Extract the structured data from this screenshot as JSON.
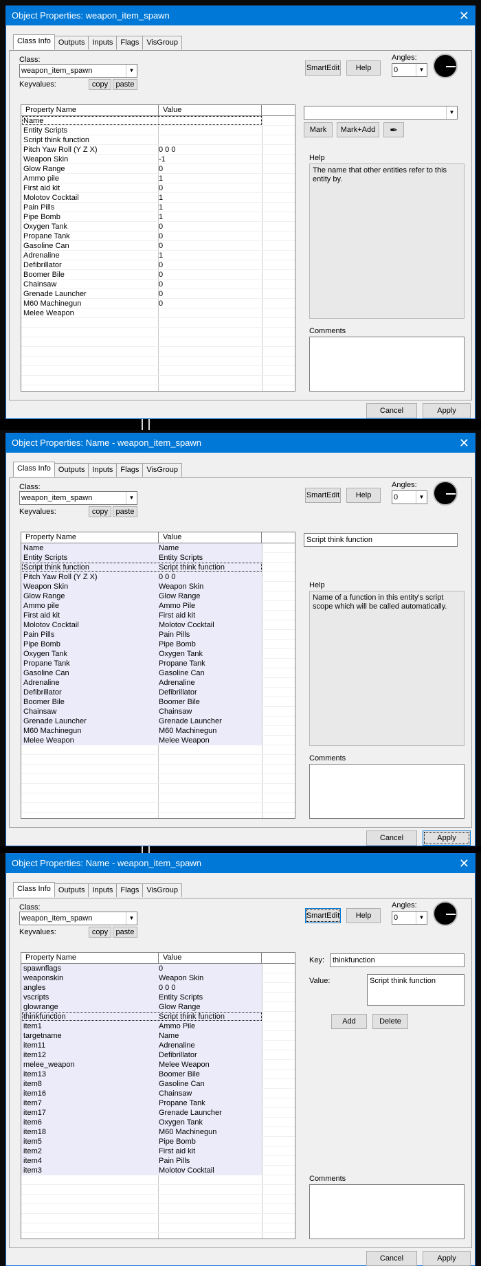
{
  "windows": [
    {
      "title": "Object Properties: weapon_item_spawn",
      "tabs": [
        "Class Info",
        "Outputs",
        "Inputs",
        "Flags",
        "VisGroup"
      ],
      "class_label": "Class:",
      "class_value": "weapon_item_spawn",
      "keyvalues_label": "Keyvalues:",
      "copy_label": "copy",
      "paste_label": "paste",
      "smartedit_label": "SmartEdit",
      "help_label": "Help",
      "angles_label": "Angles:",
      "angles_value": "0",
      "col_property": "Property Name",
      "col_value": "Value",
      "help_heading": "Help",
      "help_text": "The name that other entities refer to this entity by.",
      "comments_label": "Comments",
      "mark_label": "Mark",
      "markadd_label": "Mark+Add",
      "cancel_label": "Cancel",
      "apply_label": "Apply",
      "rows": [
        [
          "Name",
          ""
        ],
        [
          "Entity Scripts",
          ""
        ],
        [
          "Script think function",
          ""
        ],
        [
          "Pitch Yaw Roll (Y Z X)",
          "0 0 0"
        ],
        [
          "Weapon Skin",
          "-1"
        ],
        [
          "Glow Range",
          "0"
        ],
        [
          "Ammo pile",
          "1"
        ],
        [
          "First aid kit",
          "0"
        ],
        [
          "Molotov Cocktail",
          "1"
        ],
        [
          "Pain Pills",
          "1"
        ],
        [
          "Pipe Bomb",
          "1"
        ],
        [
          "Oxygen Tank",
          "0"
        ],
        [
          "Propane Tank",
          "0"
        ],
        [
          "Gasoline Can",
          "0"
        ],
        [
          "Adrenaline",
          "1"
        ],
        [
          "Defibrillator",
          "0"
        ],
        [
          "Boomer Bile",
          "0"
        ],
        [
          "Chainsaw",
          "0"
        ],
        [
          "Grenade Launcher",
          "0"
        ],
        [
          "M60 Machinegun",
          "0"
        ],
        [
          "Melee Weapon",
          ""
        ]
      ]
    },
    {
      "title": "Object Properties: Name - weapon_item_spawn",
      "tabs": [
        "Class Info",
        "Outputs",
        "Inputs",
        "Flags",
        "VisGroup"
      ],
      "class_label": "Class:",
      "class_value": "weapon_item_spawn",
      "keyvalues_label": "Keyvalues:",
      "copy_label": "copy",
      "paste_label": "paste",
      "smartedit_label": "SmartEdit",
      "help_label": "Help",
      "angles_label": "Angles:",
      "angles_value": "0",
      "col_property": "Property Name",
      "col_value": "Value",
      "field_value": "Script think function",
      "help_heading": "Help",
      "help_text": "Name of a function in this entity's script scope which will be called automatically.",
      "comments_label": "Comments",
      "cancel_label": "Cancel",
      "apply_label": "Apply",
      "rows": [
        [
          "Name",
          "Name"
        ],
        [
          "Entity Scripts",
          "Entity Scripts"
        ],
        [
          "Script think function",
          "Script think function"
        ],
        [
          "Pitch Yaw Roll (Y Z X)",
          "0 0 0"
        ],
        [
          "Weapon Skin",
          "Weapon Skin"
        ],
        [
          "Glow Range",
          "Glow Range"
        ],
        [
          "Ammo pile",
          "Ammo Pile"
        ],
        [
          "First aid kit",
          "First aid kit"
        ],
        [
          "Molotov Cocktail",
          "Molotov Cocktail"
        ],
        [
          "Pain Pills",
          "Pain Pills"
        ],
        [
          "Pipe Bomb",
          "Pipe Bomb"
        ],
        [
          "Oxygen Tank",
          "Oxygen Tank"
        ],
        [
          "Propane Tank",
          "Propane Tank"
        ],
        [
          "Gasoline Can",
          "Gasoline Can"
        ],
        [
          "Adrenaline",
          "Adrenaline"
        ],
        [
          "Defibrillator",
          "Defibrillator"
        ],
        [
          "Boomer Bile",
          "Boomer Bile"
        ],
        [
          "Chainsaw",
          "Chainsaw"
        ],
        [
          "Grenade Launcher",
          "Grenade Launcher"
        ],
        [
          "M60 Machinegun",
          "M60 Machinegun"
        ],
        [
          "Melee Weapon",
          "Melee Weapon"
        ]
      ]
    },
    {
      "title": "Object Properties: Name - weapon_item_spawn",
      "tabs": [
        "Class Info",
        "Outputs",
        "Inputs",
        "Flags",
        "VisGroup"
      ],
      "class_label": "Class:",
      "class_value": "weapon_item_spawn",
      "keyvalues_label": "Keyvalues:",
      "copy_label": "copy",
      "paste_label": "paste",
      "smartedit_label": "SmartEdit",
      "help_label": "Help",
      "angles_label": "Angles:",
      "angles_value": "0",
      "col_property": "Property Name",
      "col_value": "Value",
      "key_label": "Key:",
      "key_value": "thinkfunction",
      "value_label": "Value:",
      "value_value": "Script think function",
      "add_label": "Add",
      "delete_label": "Delete",
      "comments_label": "Comments",
      "cancel_label": "Cancel",
      "apply_label": "Apply",
      "rows": [
        [
          "spawnflags",
          "0"
        ],
        [
          "weaponskin",
          "Weapon Skin"
        ],
        [
          "angles",
          "0 0 0"
        ],
        [
          "vscripts",
          "Entity Scripts"
        ],
        [
          "glowrange",
          "Glow Range"
        ],
        [
          "thinkfunction",
          "Script think function"
        ],
        [
          "item1",
          "Ammo Pile"
        ],
        [
          "targetname",
          "Name"
        ],
        [
          "item11",
          "Adrenaline"
        ],
        [
          "item12",
          "Defibrillator"
        ],
        [
          "melee_weapon",
          "Melee Weapon"
        ],
        [
          "item13",
          "Boomer Bile"
        ],
        [
          "item8",
          "Gasoline Can"
        ],
        [
          "item16",
          "Chainsaw"
        ],
        [
          "item7",
          "Propane Tank"
        ],
        [
          "item17",
          "Grenade Launcher"
        ],
        [
          "item6",
          "Oxygen Tank"
        ],
        [
          "item18",
          "M60 Machinegun"
        ],
        [
          "item5",
          "Pipe Bomb"
        ],
        [
          "item2",
          "First aid kit"
        ],
        [
          "item4",
          "Pain Pills"
        ],
        [
          "item3",
          "Molotov Cocktail"
        ]
      ]
    }
  ]
}
